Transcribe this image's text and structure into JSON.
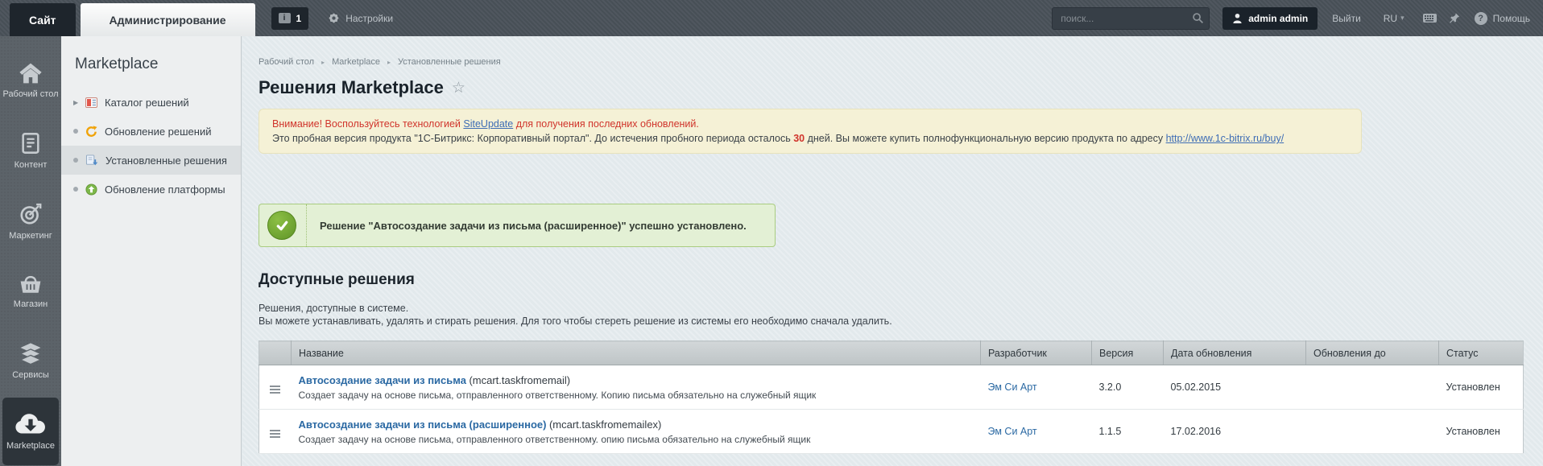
{
  "colors": {
    "topbar_bg": "#4a525a",
    "warning_bg": "#f5f1d6",
    "warning_text": "#d0342b",
    "success_bg": "#e3f0d5",
    "success_icon": "#6a9e2c",
    "link": "#2b69a3",
    "active_tile": "#2d343a"
  },
  "icons": {
    "info_glyph": "i",
    "help_glyph": "?",
    "caret_glyph": "▾",
    "star_glyph": "☆",
    "breadcrumb_sep_glyph": "▸",
    "expand_arrow_glyph": "▶"
  },
  "topbar": {
    "site_tab": "Сайт",
    "admin_tab": "Администрирование",
    "notification_count": "1",
    "settings_label": "Настройки",
    "search_placeholder": "поиск...",
    "user_label": "admin admin",
    "logout_label": "Выйти",
    "lang_label": "RU",
    "help_label": "Помощь"
  },
  "icon_sidebar": {
    "items": [
      {
        "label": "Рабочий стол",
        "icon": "home-icon"
      },
      {
        "label": "Контент",
        "icon": "document-icon"
      },
      {
        "label": "Маркетинг",
        "icon": "target-icon"
      },
      {
        "label": "Магазин",
        "icon": "basket-icon"
      },
      {
        "label": "Сервисы",
        "icon": "layers-icon"
      },
      {
        "label": "Marketplace",
        "icon": "cloud-download-icon"
      }
    ]
  },
  "menu_sidebar": {
    "title": "Marketplace",
    "items": [
      {
        "label": "Каталог решений"
      },
      {
        "label": "Обновление решений"
      },
      {
        "label": "Установленные решения"
      },
      {
        "label": "Обновление платформы"
      }
    ]
  },
  "breadcrumb": {
    "items": [
      "Рабочий стол",
      "Marketplace",
      "Установленные решения"
    ]
  },
  "page": {
    "title": "Решения Marketplace"
  },
  "notice": {
    "line1_prefix": "Внимание! Воспользуйтесь технологией ",
    "line1_link": "SiteUpdate",
    "line1_suffix": " для получения последних обновлений.",
    "line2_part1": "Это пробная версия продукта \"1С-Битрикс: Корпоративный портал\". До истечения пробного периода осталось ",
    "line2_days": "30",
    "line2_part2": " дней. Вы можете купить полнофункциональную версию продукта по адресу ",
    "line2_link": "http://www.1c-bitrix.ru/buy/"
  },
  "success": {
    "message": "Решение \"Автосоздание задачи из письма (расширенное)\" успешно установлено."
  },
  "section": {
    "heading": "Доступные решения",
    "desc1": "Решения, доступные в системе.",
    "desc2": "Вы можете устанавливать, удалять и стирать решения. Для того чтобы стереть решение из системы его необходимо сначала удалить."
  },
  "table": {
    "headers": [
      "Название",
      "Разработчик",
      "Версия",
      "Дата обновления",
      "Обновления до",
      "Статус"
    ],
    "rows": [
      {
        "name": "Автосоздание задачи из письма",
        "code": "(mcart.taskfromemail)",
        "description": "Создает задачу на основе письма, отправленного ответственному. Копию письма обязательно на служебный ящик",
        "developer": "Эм Си Арт",
        "version": "3.2.0",
        "updated": "05.02.2015",
        "updates_until": "",
        "status": "Установлен"
      },
      {
        "name": "Автосоздание задачи из письма (расширенное)",
        "code": "(mcart.taskfromemailex)",
        "description": "Создает задачу на основе письма, отправленного ответственному. опию письма обязательно на служебный ящик",
        "developer": "Эм Си Арт",
        "version": "1.1.5",
        "updated": "17.02.2016",
        "updates_until": "",
        "status": "Установлен"
      }
    ]
  }
}
